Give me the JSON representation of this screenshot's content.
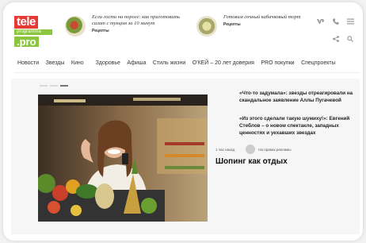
{
  "logo": {
    "line1": "tele",
    "line2": "programma",
    "line3": ".pro"
  },
  "teasers": [
    {
      "text": "Если гости на пороге: как приготовить салат с тунцом за 10 минут",
      "tag": "Рецепты"
    },
    {
      "text": "Готовим сочный кабачковый торт",
      "tag": "Рецепты"
    }
  ],
  "header_icons": {
    "vk": "vk-icon",
    "ok": "odnoklassniki-icon",
    "phone": "phone-icon",
    "menu": "menu-icon",
    "share": "share-icon",
    "search": "search-icon"
  },
  "nav": [
    "Новости",
    "Звезды",
    "Кино",
    "Здоровье",
    "Афиша",
    "Стиль жизни",
    "О'КЕЙ – 20 лет доверия",
    "PRO покупки",
    "Спецпроекты"
  ],
  "feature": {
    "time": "1 час назад",
    "rubric": "На правах рекламы",
    "title": "Шопинг как отдых"
  },
  "side_news": [
    {
      "title": "«Что-то задумала»: звезды отреагировали на скандальное заявление Аллы Пугачевой"
    },
    {
      "title": "«Из этого сделали такую шумиху!»: Евгений Стеблов – о новом спектакле, западных ценностях и уехавших звездах"
    }
  ],
  "colors": {
    "logo_red": "#e53a36",
    "logo_green": "#8cc63f"
  }
}
